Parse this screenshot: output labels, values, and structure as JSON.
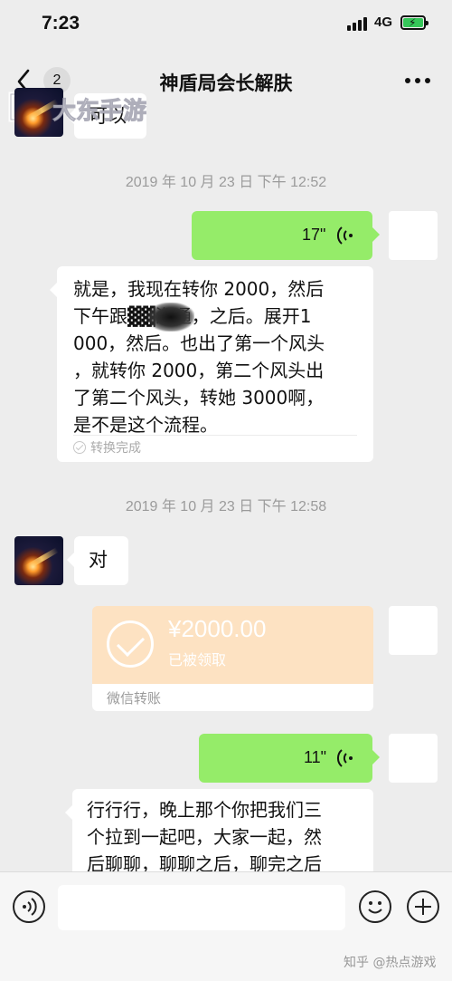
{
  "status_bar": {
    "time": "7:23",
    "network": "4G",
    "battery_level": 1.0
  },
  "nav": {
    "back_count": "2",
    "title": "神盾局会长解肤"
  },
  "watermark": {
    "top_brand": "大东手游",
    "bottom": "知乎 @热点游戏"
  },
  "messages": {
    "first_in_text": "可以",
    "time1": "2019 年 10 月 23 日 下午 12:52",
    "voice1_duration": "17\"",
    "conv1_lines": [
      "就是，我现在转你 2000，然后",
      "下午跟▓▓沟通，之后。展开1",
      "000，然后。也出了第一个风头",
      "，就转你 2000，第二个风头出",
      "了第二个风头，转她 3000啊，",
      "是不是这个流程。"
    ],
    "conv1_status": "转换完成",
    "time2": "2019 年 10 月 23 日 下午 12:58",
    "reply_in_text": "对",
    "transfer": {
      "amount": "¥2000.00",
      "status": "已被领取",
      "label": "微信转账"
    },
    "voice2_duration": "11\"",
    "conv2_lines": [
      "行行行，晚上那个你把我们三",
      "个拉到一起吧，大家一起，然",
      "后聊聊，聊聊之后，聊完之后"
    ]
  },
  "colors": {
    "outgoing_bubble": "#95ec69",
    "transfer_card": "#fde2c2",
    "background": "#ededed"
  },
  "icons": [
    "back-chevron-icon",
    "more-icon",
    "voice-wave-icon",
    "check-circle-icon",
    "voice-input-icon",
    "emoji-icon",
    "plus-icon"
  ]
}
